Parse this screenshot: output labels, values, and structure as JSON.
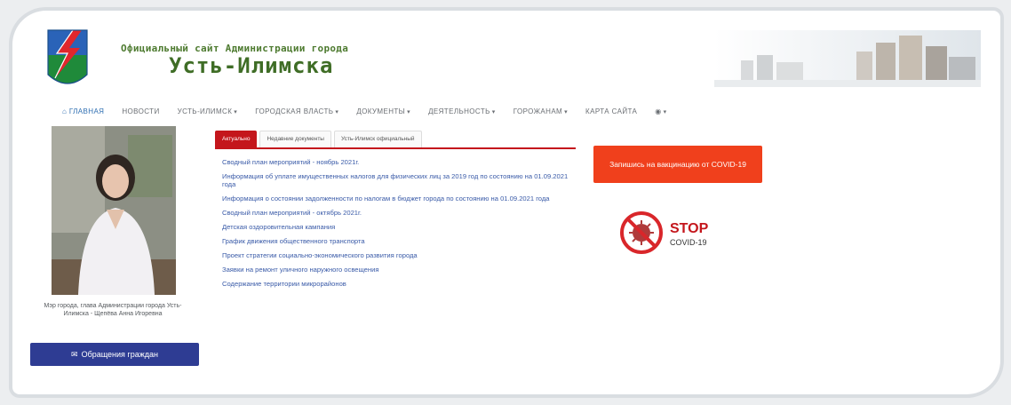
{
  "header": {
    "subtitle": "Официальный сайт Администрации города",
    "title": "Усть-Илимска"
  },
  "nav": {
    "items": [
      {
        "label": "ГЛАВНАЯ",
        "active": true,
        "dropdown": false
      },
      {
        "label": "НОВОСТИ",
        "active": false,
        "dropdown": false
      },
      {
        "label": "УСТЬ-ИЛИМСК",
        "active": false,
        "dropdown": true
      },
      {
        "label": "ГОРОДСКАЯ ВЛАСТЬ",
        "active": false,
        "dropdown": true
      },
      {
        "label": "ДОКУМЕНТЫ",
        "active": false,
        "dropdown": true
      },
      {
        "label": "ДЕЯТЕЛЬНОСТЬ",
        "active": false,
        "dropdown": true
      },
      {
        "label": "ГОРОЖАНАМ",
        "active": false,
        "dropdown": true
      },
      {
        "label": "КАРТА САЙТА",
        "active": false,
        "dropdown": false
      }
    ]
  },
  "sidebar": {
    "caption": "Мэр города, глава Администрации города Усть-Илимска - Щепёва Анна Игоревна",
    "appeal_button": "Обращения граждан"
  },
  "tabs": [
    "Актуально",
    "Недавние документы",
    "Усть-Илимск официальный"
  ],
  "news": [
    "Сводный план мероприятий - ноябрь 2021г.",
    "Информация об уплате имущественных налогов для физических лиц за 2019 год по состоянию на 01.09.2021 года",
    "Информация о состоянии задолженности по налогам в бюджет города по состоянию на 01.09.2021 года",
    "Сводный план мероприятий - октябрь 2021г.",
    "Детская оздоровительная кампания",
    "График движения общественного транспорта",
    "Проект стратегии социально-экономического развития города",
    "Заявки на ремонт уличного наружного освещения",
    "Содержание территории микрорайонов"
  ],
  "covid": {
    "button": "Запишись на вакцинацию от COVID-19",
    "stop_word": "STOP",
    "stop_sub": "COVID-19"
  },
  "colors": {
    "accent_red": "#c4161c",
    "button_blue": "#2e3c93",
    "covid_orange": "#f0401c",
    "link_blue": "#3a5ba8",
    "title_green": "#3f6d26"
  }
}
